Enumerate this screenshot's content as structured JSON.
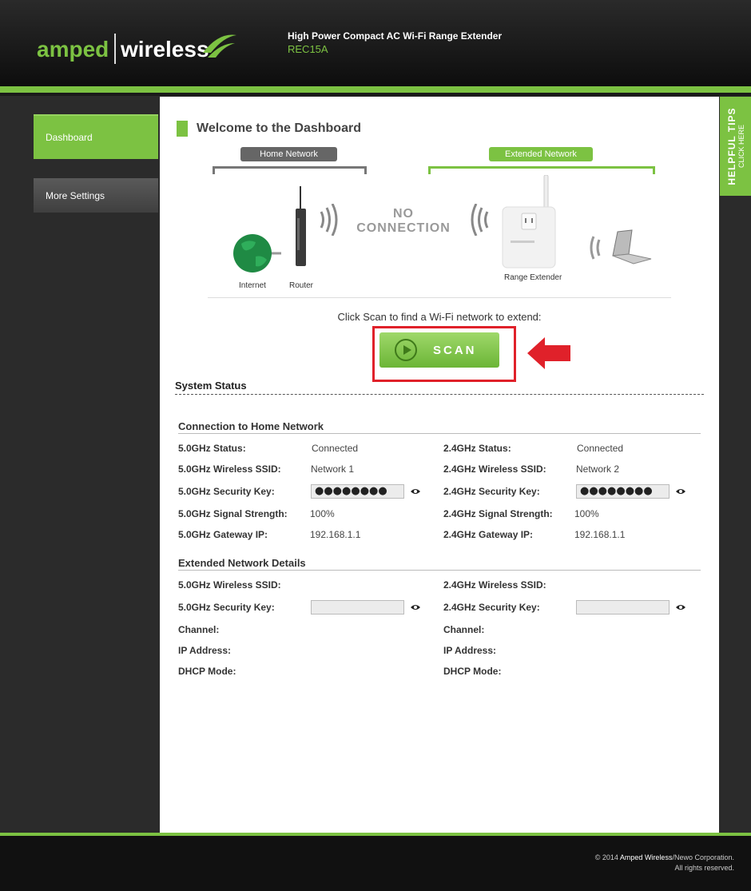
{
  "brand": {
    "amped": "amped",
    "wireless": "wireless",
    "color": "#7cc242"
  },
  "header": {
    "product_title": "High Power Compact AC Wi-Fi Range Extender",
    "model": "REC15A"
  },
  "sidebar": {
    "items": [
      {
        "label": "Dashboard",
        "active": true
      },
      {
        "label": "More Settings",
        "active": false
      }
    ]
  },
  "tips": {
    "title": "HELPFUL TIPS",
    "subtitle": "CLICK HERE"
  },
  "dashboard": {
    "title": "Welcome to the Dashboard",
    "home_network_label": "Home Network",
    "extended_network_label": "Extended Network",
    "diagram_labels": {
      "internet": "Internet",
      "router": "Router",
      "range_extender": "Range Extender"
    },
    "no_connection_line1": "NO",
    "no_connection_line2": "CONNECTION"
  },
  "scan": {
    "prompt": "Click Scan to find a Wi-Fi network to extend:",
    "button_label": "SCAN"
  },
  "system_status": {
    "title": "System Status",
    "connection": {
      "title": "Connection to Home Network",
      "left": [
        {
          "label": "5.0GHz Status:",
          "value": "Connected"
        },
        {
          "label": "5.0GHz Wireless SSID:",
          "value": "Network 1"
        },
        {
          "label": "5.0GHz Security Key:",
          "value": "●●●●●●●●"
        },
        {
          "label": "5.0GHz Signal Strength:",
          "value": "100%"
        },
        {
          "label": "5.0GHz Gateway IP:",
          "value": "192.168.1.1"
        }
      ],
      "right": [
        {
          "label": "2.4GHz Status:",
          "value": "Connected"
        },
        {
          "label": "2.4GHz Wireless SSID:",
          "value": "Network 2"
        },
        {
          "label": "2.4GHz Security Key:",
          "value": "●●●●●●●●"
        },
        {
          "label": "2.4GHz Signal Strength:",
          "value": "100%"
        },
        {
          "label": "2.4GHz Gateway IP:",
          "value": "192.168.1.1"
        }
      ]
    },
    "extended": {
      "title": "Extended Network Details",
      "left": [
        {
          "label": "5.0GHz Wireless SSID:"
        },
        {
          "label": "5.0GHz Security Key:",
          "value": ""
        },
        {
          "label": "Channel:"
        },
        {
          "label": "IP Address:"
        },
        {
          "label": "DHCP Mode:"
        }
      ],
      "right": [
        {
          "label": "2.4GHz Wireless SSID:"
        },
        {
          "label": "2.4GHz Security Key:",
          "value": ""
        },
        {
          "label": "Channel:"
        },
        {
          "label": "IP Address:"
        },
        {
          "label": "DHCP Mode:"
        }
      ]
    }
  },
  "footer": {
    "copyright_prefix": "© 2014 ",
    "copyright_brand": "Amped Wireless",
    "copyright_suffix": "/Newo Corporation.",
    "rights": "All rights reserved."
  }
}
